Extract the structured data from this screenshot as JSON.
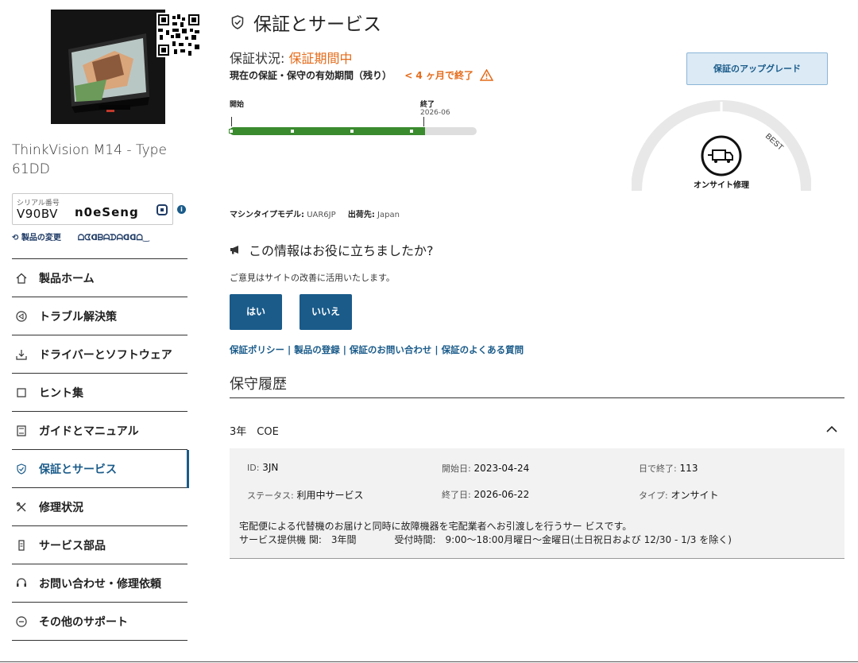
{
  "sidebar": {
    "product_name": "ThinkVision M14 - Type 61DD",
    "serial_label": "シリアル番号",
    "serial_value": "V90BV",
    "serial_obscured": "n0eSeng",
    "change_product": "製品の変更",
    "change_product_extra": "ᗝᗧᗡᗷᗩᗪᗩᗡᗡᗝ‿",
    "nav": [
      {
        "label": "製品ホーム",
        "icon": "home-icon"
      },
      {
        "label": "トラブル解決策",
        "icon": "troubleshoot-icon"
      },
      {
        "label": "ドライバーとソフトウェア",
        "icon": "download-icon"
      },
      {
        "label": "ヒント集",
        "icon": "tips-icon"
      },
      {
        "label": "ガイドとマニュアル",
        "icon": "manual-icon"
      },
      {
        "label": "保証とサービス",
        "icon": "shield-icon"
      },
      {
        "label": "修理状況",
        "icon": "tools-icon"
      },
      {
        "label": "サービス部品",
        "icon": "parts-icon"
      },
      {
        "label": "お問い合わせ・修理依頼",
        "icon": "support-icon"
      },
      {
        "label": "その他のサポート",
        "icon": "more-icon"
      }
    ],
    "active_index": 5
  },
  "main": {
    "title": "保証とサービス",
    "status_label": "保証状況:",
    "status_value": "保証期間中",
    "period_label": "現在の保証・保守の有効期間（残り）",
    "remaining": "< 4 ヶ月で終了",
    "upgrade_button": "保証のアップグレード",
    "timeline": {
      "start_label": "開始",
      "end_label": "終了",
      "end_date": "2026-06",
      "progress": 0.79
    },
    "gauge": {
      "best_label": "BEST",
      "service_label": "オンサイト修理"
    },
    "machine": {
      "model_label": "マシンタイプモデル:",
      "model_value": "UAR6JP",
      "ship_label": "出荷先:",
      "ship_value": "Japan"
    },
    "feedback": {
      "question": "この情報はお役に立ちましたか?",
      "sub": "ご意見はサイトの改善に活用いたします。",
      "yes": "はい",
      "no": "いいえ"
    },
    "links": [
      "保証ポリシー",
      "製品の登録",
      "保証のお問い合わせ",
      "保証のよくある質問"
    ],
    "history": {
      "title": "保守履歴",
      "entry": {
        "header": "3年　COE",
        "id_label": "ID:",
        "id_value": "3JN",
        "start_label": "開始日:",
        "start_value": "2023-04-24",
        "days_label": "日で終了:",
        "days_value": "113",
        "status_label": "ステータス:",
        "status_value": "利用中サービス",
        "end_label": "終了日:",
        "end_value": "2026-06-22",
        "type_label": "タイプ:",
        "type_value": "オンサイト",
        "description_1": "宅配便による代替機のお届けと同時に故障機器を宅配業者へお引渡しを行うサー ビスです。",
        "description_2": "サービス提供機 関:　3年間　　　　受付時間:　9:00〜18:00月曜日〜金曜日(土日祝日および 12/30 - 1/3 を除く)"
      }
    }
  },
  "colors": {
    "accent": "#1a5b8a",
    "warning": "#e46b1a",
    "progress": "#3a8a2e"
  }
}
